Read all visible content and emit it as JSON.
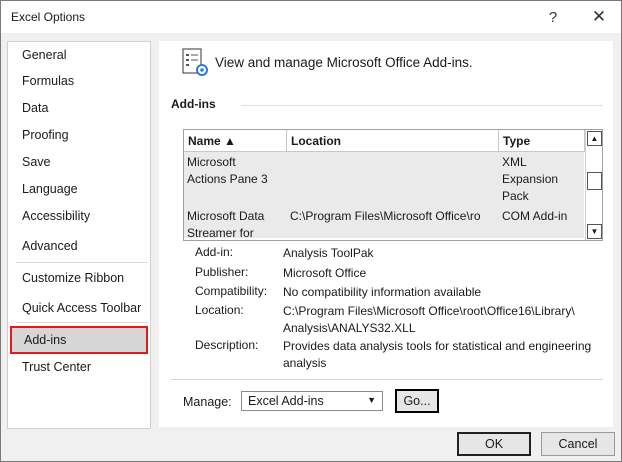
{
  "window": {
    "title": "Excel Options",
    "help": "?",
    "close": "✕"
  },
  "sidebar": {
    "items": [
      {
        "label": "General"
      },
      {
        "label": "Formulas"
      },
      {
        "label": "Data"
      },
      {
        "label": "Proofing"
      },
      {
        "label": "Save"
      },
      {
        "label": "Language"
      },
      {
        "label": "Accessibility"
      },
      {
        "label": "Advanced"
      },
      {
        "label": "Customize Ribbon"
      },
      {
        "label": "Quick Access Toolbar"
      },
      {
        "label": "Add-ins",
        "selected": true
      },
      {
        "label": "Trust Center"
      }
    ]
  },
  "main": {
    "header": "View and manage Microsoft Office Add-ins.",
    "section_title": "Add-ins",
    "table": {
      "columns": [
        {
          "label": "Name ▲"
        },
        {
          "label": "Location"
        },
        {
          "label": "Type"
        }
      ],
      "rows": [
        {
          "name": [
            "Microsoft",
            "Actions Pane 3"
          ],
          "location": "",
          "type": [
            "XML",
            "Expansion",
            "Pack"
          ]
        },
        {
          "name": [
            "Microsoft Data",
            "Streamer for"
          ],
          "location": "C:\\Program Files\\Microsoft Office\\ro",
          "type": [
            "COM Add-in"
          ]
        }
      ]
    },
    "details": {
      "addin": {
        "label": "Add-in:",
        "value": "Analysis ToolPak"
      },
      "publisher": {
        "label": "Publisher:",
        "value": "Microsoft Office"
      },
      "compatibility": {
        "label": "Compatibility:",
        "value": "No compatibility information available"
      },
      "location": {
        "label": "Location:",
        "value": "C:\\Program Files\\Microsoft Office\\root\\Office16\\Library\\ Analysis\\ANALYS32.XLL"
      },
      "description": {
        "label": "Description:",
        "value": "Provides data analysis tools for statistical and engineering analysis"
      }
    },
    "manage": {
      "label": "Manage:",
      "selected": "Excel Add-ins",
      "go": "Go..."
    }
  },
  "footer": {
    "ok": "OK",
    "cancel": "Cancel"
  }
}
